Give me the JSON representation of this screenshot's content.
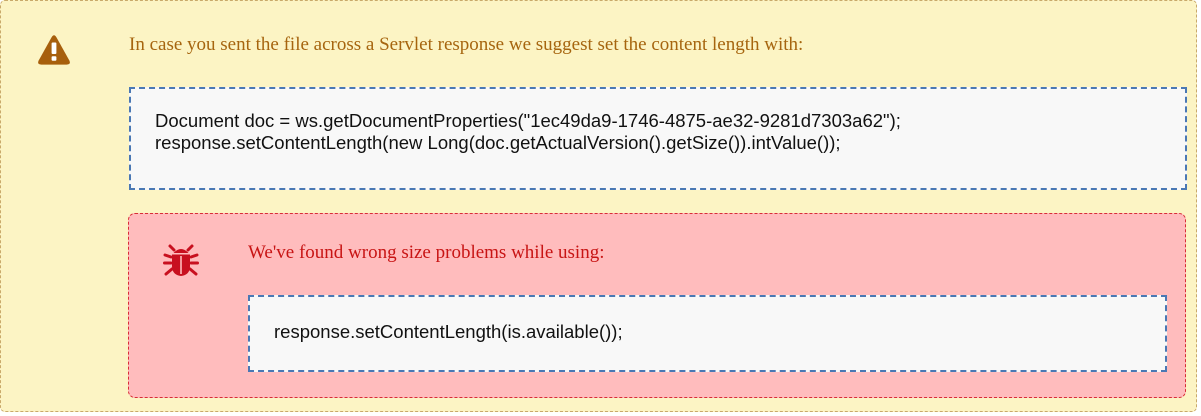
{
  "warning": {
    "icon": "warning-icon",
    "color": "#a6650f",
    "background": "#fcf4c4",
    "message": "In case you sent the file across a Servlet response we suggest set the content length with:",
    "code": [
      "Document doc = ws.getDocumentProperties(\"1ec49da9-1746-4875-ae32-9281d7303a62\");",
      "response.setContentLength(new Long(doc.getActualVersion().getSize()).intValue());"
    ]
  },
  "error": {
    "icon": "bug-icon",
    "color": "#c81414",
    "background": "#ffbcbd",
    "message": "We've found wrong size problems while using:",
    "code": [
      "response.setContentLength(is.available());"
    ]
  }
}
